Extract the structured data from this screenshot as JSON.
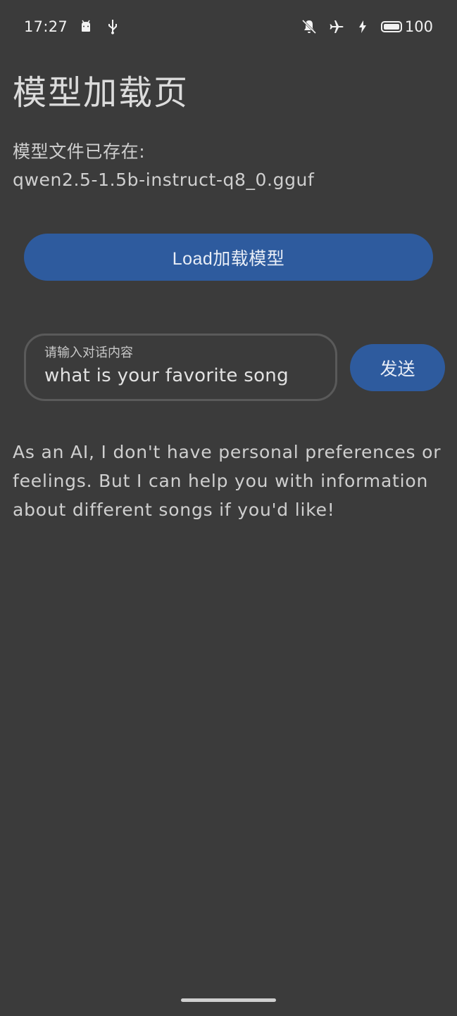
{
  "status_bar": {
    "time": "17:27",
    "battery_level": "100",
    "icons": [
      "android-icon",
      "usb-icon",
      "mute-icon",
      "airplane-icon",
      "charging-icon",
      "battery-icon"
    ]
  },
  "page": {
    "title": "模型加载页",
    "model_info_label": "模型文件已存在:",
    "model_file_name": "qwen2.5-1.5b-instruct-q8_0.gguf",
    "load_button_label": "Load加载模型"
  },
  "chat": {
    "input_label": "请输入对话内容",
    "input_value": "what is your favorite song",
    "send_button_label": "发送",
    "response": "As an AI, I don't have personal preferences or feelings. But I can help you with information about different songs if you'd like!"
  },
  "colors": {
    "background": "#3b3b3b",
    "accent": "#2e5b9e",
    "text": "#cfcfcf"
  }
}
